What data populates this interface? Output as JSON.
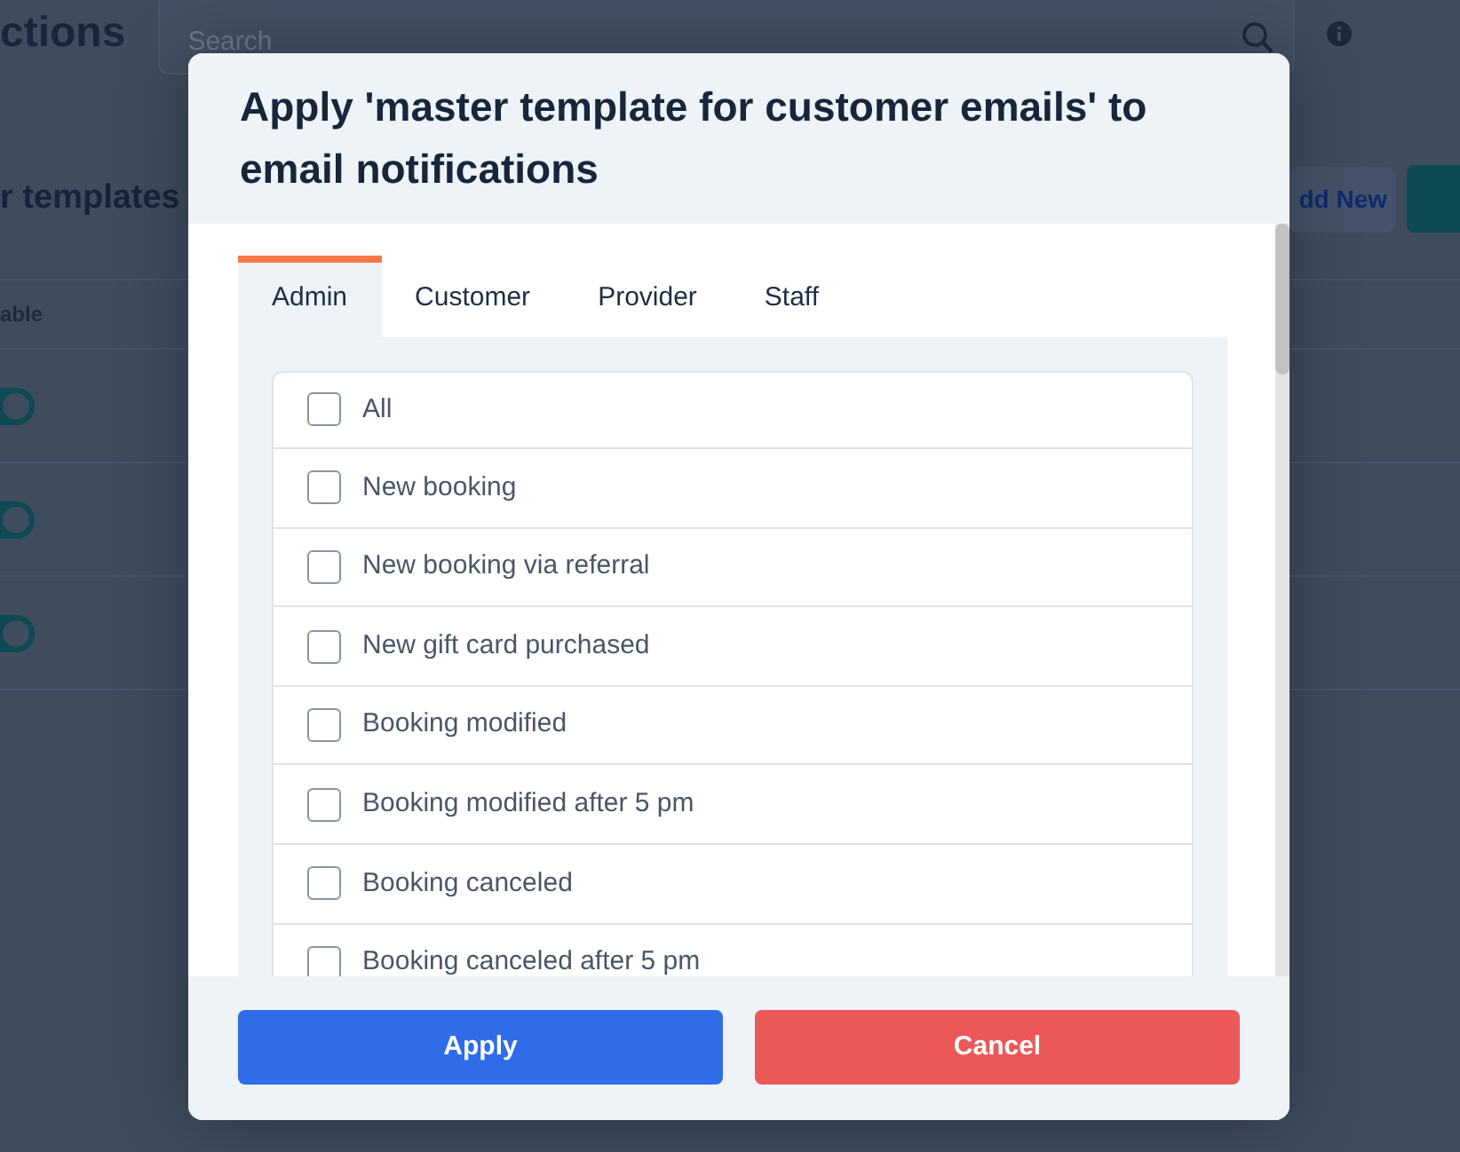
{
  "background": {
    "page_title": "ctions",
    "search": {
      "placeholder": "Search"
    },
    "section_title": "r templates",
    "add_button": "dd New",
    "table": {
      "column_1": "able",
      "rows": [
        {
          "on": true
        },
        {
          "on": true
        },
        {
          "on": true
        }
      ]
    }
  },
  "modal": {
    "title": "Apply 'master template for customer emails' to email notifications",
    "tabs": [
      {
        "label": "Admin",
        "selected": true
      },
      {
        "label": "Customer",
        "selected": false
      },
      {
        "label": "Provider",
        "selected": false
      },
      {
        "label": "Staff",
        "selected": false
      }
    ],
    "items": [
      {
        "label": "All",
        "checked": false
      },
      {
        "label": "New booking",
        "checked": false
      },
      {
        "label": "New booking via referral",
        "checked": false
      },
      {
        "label": "New gift card purchased",
        "checked": false
      },
      {
        "label": "Booking modified",
        "checked": false
      },
      {
        "label": "Booking modified after 5 pm",
        "checked": false
      },
      {
        "label": "Booking canceled",
        "checked": false
      },
      {
        "label": "Booking canceled after 5 pm",
        "checked": false
      }
    ],
    "buttons": {
      "apply": "Apply",
      "cancel": "Cancel"
    }
  }
}
